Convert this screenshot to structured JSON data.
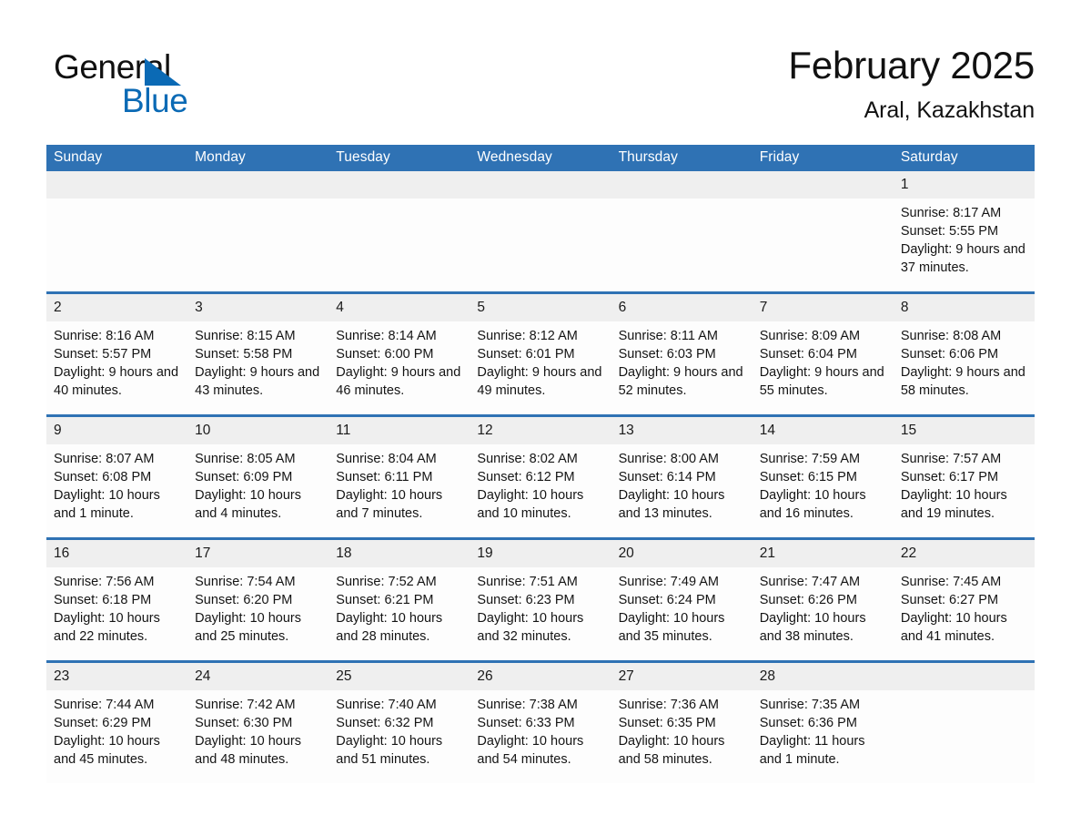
{
  "brand": {
    "name_part1": "General",
    "name_part2": "Blue",
    "triangle_color": "#0b6ab5"
  },
  "header": {
    "title": "February 2025",
    "location": "Aral, Kazakhstan"
  },
  "theme": {
    "header_blue": "#2f72b4",
    "daynum_band": "#efefef",
    "page_bg": "#ffffff"
  },
  "calendar": {
    "weekday_headers": [
      "Sunday",
      "Monday",
      "Tuesday",
      "Wednesday",
      "Thursday",
      "Friday",
      "Saturday"
    ],
    "labels": {
      "sunrise": "Sunrise:",
      "sunset": "Sunset:",
      "daylight": "Daylight:"
    },
    "weeks": [
      [
        {
          "day": "",
          "empty": true
        },
        {
          "day": "",
          "empty": true
        },
        {
          "day": "",
          "empty": true
        },
        {
          "day": "",
          "empty": true
        },
        {
          "day": "",
          "empty": true
        },
        {
          "day": "",
          "empty": true
        },
        {
          "day": "1",
          "sunrise": "Sunrise: 8:17 AM",
          "sunset": "Sunset: 5:55 PM",
          "daylight": "Daylight: 9 hours and 37 minutes."
        }
      ],
      [
        {
          "day": "2",
          "sunrise": "Sunrise: 8:16 AM",
          "sunset": "Sunset: 5:57 PM",
          "daylight": "Daylight: 9 hours and 40 minutes."
        },
        {
          "day": "3",
          "sunrise": "Sunrise: 8:15 AM",
          "sunset": "Sunset: 5:58 PM",
          "daylight": "Daylight: 9 hours and 43 minutes."
        },
        {
          "day": "4",
          "sunrise": "Sunrise: 8:14 AM",
          "sunset": "Sunset: 6:00 PM",
          "daylight": "Daylight: 9 hours and 46 minutes."
        },
        {
          "day": "5",
          "sunrise": "Sunrise: 8:12 AM",
          "sunset": "Sunset: 6:01 PM",
          "daylight": "Daylight: 9 hours and 49 minutes."
        },
        {
          "day": "6",
          "sunrise": "Sunrise: 8:11 AM",
          "sunset": "Sunset: 6:03 PM",
          "daylight": "Daylight: 9 hours and 52 minutes."
        },
        {
          "day": "7",
          "sunrise": "Sunrise: 8:09 AM",
          "sunset": "Sunset: 6:04 PM",
          "daylight": "Daylight: 9 hours and 55 minutes."
        },
        {
          "day": "8",
          "sunrise": "Sunrise: 8:08 AM",
          "sunset": "Sunset: 6:06 PM",
          "daylight": "Daylight: 9 hours and 58 minutes."
        }
      ],
      [
        {
          "day": "9",
          "sunrise": "Sunrise: 8:07 AM",
          "sunset": "Sunset: 6:08 PM",
          "daylight": "Daylight: 10 hours and 1 minute."
        },
        {
          "day": "10",
          "sunrise": "Sunrise: 8:05 AM",
          "sunset": "Sunset: 6:09 PM",
          "daylight": "Daylight: 10 hours and 4 minutes."
        },
        {
          "day": "11",
          "sunrise": "Sunrise: 8:04 AM",
          "sunset": "Sunset: 6:11 PM",
          "daylight": "Daylight: 10 hours and 7 minutes."
        },
        {
          "day": "12",
          "sunrise": "Sunrise: 8:02 AM",
          "sunset": "Sunset: 6:12 PM",
          "daylight": "Daylight: 10 hours and 10 minutes."
        },
        {
          "day": "13",
          "sunrise": "Sunrise: 8:00 AM",
          "sunset": "Sunset: 6:14 PM",
          "daylight": "Daylight: 10 hours and 13 minutes."
        },
        {
          "day": "14",
          "sunrise": "Sunrise: 7:59 AM",
          "sunset": "Sunset: 6:15 PM",
          "daylight": "Daylight: 10 hours and 16 minutes."
        },
        {
          "day": "15",
          "sunrise": "Sunrise: 7:57 AM",
          "sunset": "Sunset: 6:17 PM",
          "daylight": "Daylight: 10 hours and 19 minutes."
        }
      ],
      [
        {
          "day": "16",
          "sunrise": "Sunrise: 7:56 AM",
          "sunset": "Sunset: 6:18 PM",
          "daylight": "Daylight: 10 hours and 22 minutes."
        },
        {
          "day": "17",
          "sunrise": "Sunrise: 7:54 AM",
          "sunset": "Sunset: 6:20 PM",
          "daylight": "Daylight: 10 hours and 25 minutes."
        },
        {
          "day": "18",
          "sunrise": "Sunrise: 7:52 AM",
          "sunset": "Sunset: 6:21 PM",
          "daylight": "Daylight: 10 hours and 28 minutes."
        },
        {
          "day": "19",
          "sunrise": "Sunrise: 7:51 AM",
          "sunset": "Sunset: 6:23 PM",
          "daylight": "Daylight: 10 hours and 32 minutes."
        },
        {
          "day": "20",
          "sunrise": "Sunrise: 7:49 AM",
          "sunset": "Sunset: 6:24 PM",
          "daylight": "Daylight: 10 hours and 35 minutes."
        },
        {
          "day": "21",
          "sunrise": "Sunrise: 7:47 AM",
          "sunset": "Sunset: 6:26 PM",
          "daylight": "Daylight: 10 hours and 38 minutes."
        },
        {
          "day": "22",
          "sunrise": "Sunrise: 7:45 AM",
          "sunset": "Sunset: 6:27 PM",
          "daylight": "Daylight: 10 hours and 41 minutes."
        }
      ],
      [
        {
          "day": "23",
          "sunrise": "Sunrise: 7:44 AM",
          "sunset": "Sunset: 6:29 PM",
          "daylight": "Daylight: 10 hours and 45 minutes."
        },
        {
          "day": "24",
          "sunrise": "Sunrise: 7:42 AM",
          "sunset": "Sunset: 6:30 PM",
          "daylight": "Daylight: 10 hours and 48 minutes."
        },
        {
          "day": "25",
          "sunrise": "Sunrise: 7:40 AM",
          "sunset": "Sunset: 6:32 PM",
          "daylight": "Daylight: 10 hours and 51 minutes."
        },
        {
          "day": "26",
          "sunrise": "Sunrise: 7:38 AM",
          "sunset": "Sunset: 6:33 PM",
          "daylight": "Daylight: 10 hours and 54 minutes."
        },
        {
          "day": "27",
          "sunrise": "Sunrise: 7:36 AM",
          "sunset": "Sunset: 6:35 PM",
          "daylight": "Daylight: 10 hours and 58 minutes."
        },
        {
          "day": "28",
          "sunrise": "Sunrise: 7:35 AM",
          "sunset": "Sunset: 6:36 PM",
          "daylight": "Daylight: 11 hours and 1 minute."
        },
        {
          "day": "",
          "empty": true
        }
      ]
    ]
  }
}
